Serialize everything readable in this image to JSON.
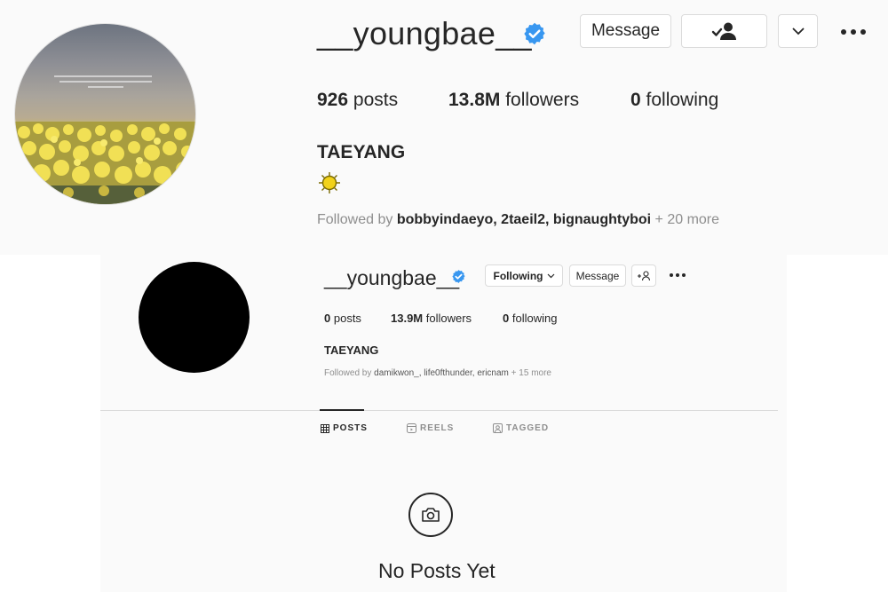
{
  "old_profile": {
    "username": "__youngbae__",
    "message_label": "Message",
    "stats": {
      "posts_count": "926",
      "posts_label": "posts",
      "followers_count": "13.8M",
      "followers_label": "followers",
      "following_count": "0",
      "following_label": "following"
    },
    "display_name": "TAEYANG",
    "followed_by_prefix": "Followed by",
    "followed_by_names": "bobbyindaeyo, 2taeil2, bignaughtyboi",
    "followed_by_more": "+ 20 more",
    "icons": [
      "verified-icon",
      "person-check-icon",
      "chevron-down-icon",
      "more-icon",
      "sun-emoji-icon"
    ]
  },
  "new_profile": {
    "username": "__youngbae__",
    "following_label": "Following",
    "message_label": "Message",
    "add_user_label": "+",
    "stats": {
      "posts_count": "0",
      "posts_label": "posts",
      "followers_count": "13.9M",
      "followers_label": "followers",
      "following_count": "0",
      "following_label": "following"
    },
    "display_name": "TAEYANG",
    "followed_by_prefix": "Followed by",
    "followed_by_names": "damikwon_, life0fthunder, ericnam",
    "followed_by_more": "+ 15 more",
    "tabs": [
      {
        "label": "POSTS",
        "icon": "grid-icon",
        "active": true
      },
      {
        "label": "REELS",
        "icon": "reels-icon",
        "active": false
      },
      {
        "label": "TAGGED",
        "icon": "tagged-icon",
        "active": false
      }
    ],
    "empty_state": "No Posts Yet"
  },
  "colors": {
    "verified": "#3897f0",
    "text": "#262626",
    "muted": "#8e8e8e",
    "border": "#dbdbdb"
  }
}
